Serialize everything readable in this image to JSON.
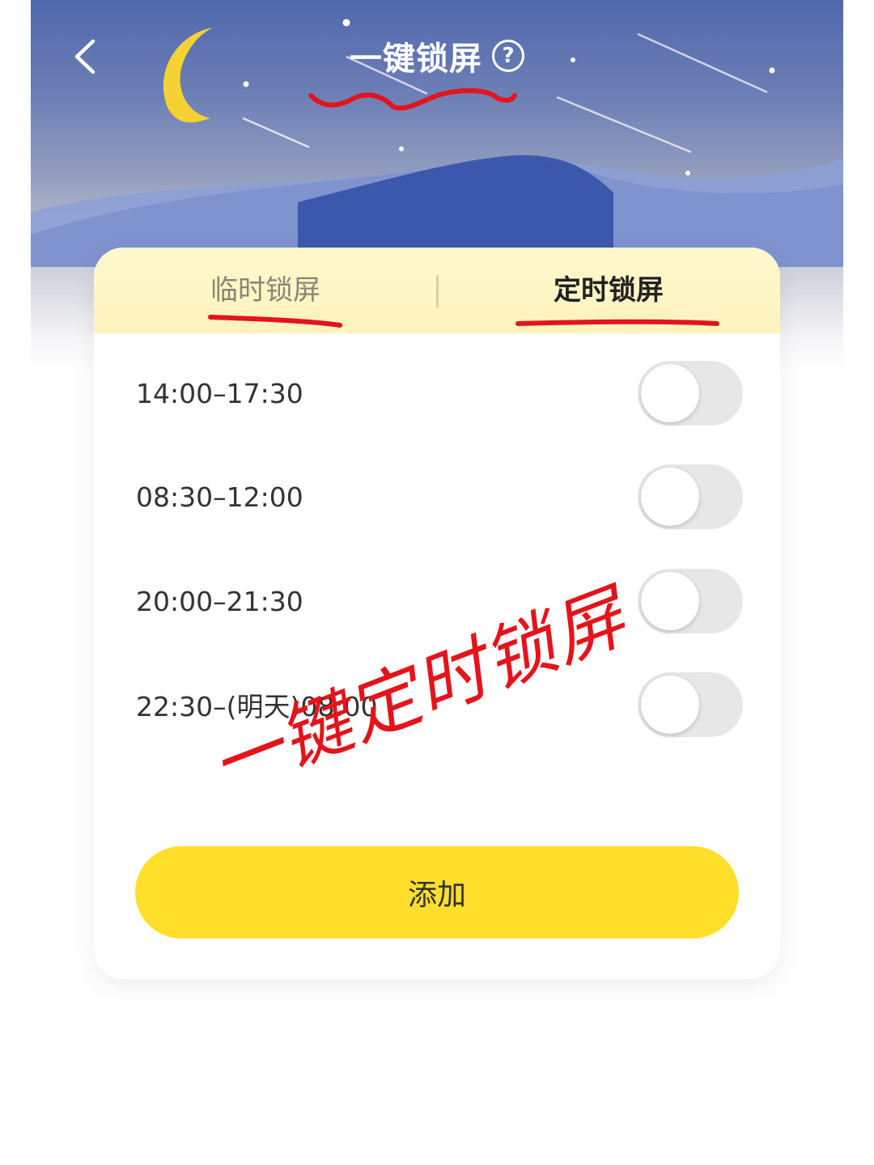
{
  "header": {
    "title": "一键锁屏",
    "help_symbol": "?",
    "back_icon": "chevron-left-icon"
  },
  "tabs": [
    {
      "label": "临时锁屏",
      "active": false
    },
    {
      "label": "定时锁屏",
      "active": true
    }
  ],
  "schedules": [
    {
      "time": "14:00–17:30",
      "enabled": false
    },
    {
      "time": "08:30–12:00",
      "enabled": false
    },
    {
      "time": "20:00–21:30",
      "enabled": false
    },
    {
      "time": "22:30–(明天)08:00",
      "enabled": false
    }
  ],
  "add_button": {
    "label": "添加"
  },
  "annotation": {
    "text": "一键定时锁屏",
    "color": "#e4141b"
  },
  "colors": {
    "accent_yellow": "#ffdf2a",
    "sky_blue": "#5068ad",
    "annotation_red": "#e4141b"
  }
}
